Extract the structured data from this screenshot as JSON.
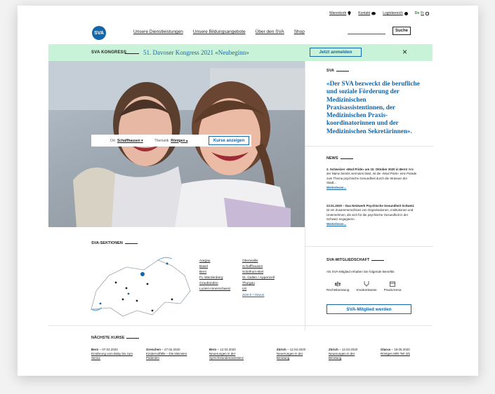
{
  "utility_nav": {
    "warenkorb": "Warenkorb",
    "kontakt": "Kontakt",
    "login": "Loginbereich",
    "lang_de": "De",
    "lang_fr": "Fr"
  },
  "logo_text": "SVA",
  "main_nav": [
    "Unsere Dienstleistungen",
    "Unsere Bildungsangebote",
    "Über den SVA",
    "Shop"
  ],
  "search": {
    "button": "Suche"
  },
  "banner": {
    "tag": "SVA KONGRESS",
    "title": "51. Davoser Kongress 2021 «Neubeginn»",
    "cta": "Jetzt anmelden",
    "close": "×"
  },
  "filter": {
    "ort_label": "Ort",
    "ort_value": "Schaffhausen",
    "thematik_label": "Thematik",
    "thematik_value": "Röntgen",
    "button": "Kurse anzeigen"
  },
  "intro": {
    "heading": "SVA",
    "quote": "«Der SVA bezweckt die berufliche und soziale Förderung der Medizinischen Praxisassistentinnen, der Medizinischen Praxis-koordinatorinnen und der Medizinischen Sekretärinnen»."
  },
  "news": {
    "heading": "NEWS",
    "items": [
      {
        "title": "2. Schweizer «Mod Pride» am 10. Oktober 2020 in Bern!",
        "text": "Wie der Name bereits vermuten lässt, ist die «Mod Pride» eine Parade zum Thema psychische Gesundheit durch die Strassen der Stadt...",
        "more": "Weiterlesen..."
      },
      {
        "title": "22.01.2020 – Das Netzwerk Psychische Gesundheit Schweiz",
        "text": "ist ein Zusammenschluss von Organisationen, Institutionen und Unternehmen, die sich für die psychische Gesundheit in der Schweiz engagieren.",
        "more": "Weiterlesen..."
      }
    ]
  },
  "membership": {
    "heading": "SVA-MITGLIEDSCHAFT",
    "text": "Als SVA-Mitglied erhalten Sie folgende Benefits",
    "benefits": [
      "Rechtsberatung",
      "Krankenkasse",
      "PraxisArena"
    ],
    "button": "SVA-Mitglied werden"
  },
  "sections": {
    "heading": "SVA-SEKTIONEN",
    "col1": [
      "Aargau",
      "Basel",
      "Bern",
      "FL-Werdenberg",
      "Graubünden",
      "Luzern-Innerschweiz"
    ],
    "col2": [
      "Oberwallis",
      "Schaffhausen",
      "Solothurn-Biel",
      "St. Gallen / Appenzell",
      "Thurgau",
      "Uri",
      "Zürich / Glarus"
    ]
  },
  "courses": {
    "heading": "NÄCHSTE KURSE",
    "items": [
      {
        "city": "Bern",
        "date": "– 07.03.2020",
        "title": "Ernährung vom Baby bis zum Senior"
      },
      {
        "city": "Grenchen",
        "date": "– 27.02.2020",
        "title": "Kindernotfälle – Die kleinsten Patienten"
      },
      {
        "city": "Bern",
        "date": "– 12.03.2020",
        "title": "Neuerungen in der Sprechstundenassistenz"
      },
      {
        "city": "Zürich",
        "date": "– 12.03.2020",
        "title": "Neuerungen in der Beratung"
      },
      {
        "city": "Zürich",
        "date": "– 12.03.2020",
        "title": "Neuerungen in der Beratung"
      },
      {
        "city": "Glarus",
        "date": "– 18.05.2020",
        "title": "Röntgen MRI Teil 4/5"
      }
    ]
  },
  "colors": {
    "brand_blue": "#1466a8",
    "banner_green": "#c9f3d9"
  }
}
